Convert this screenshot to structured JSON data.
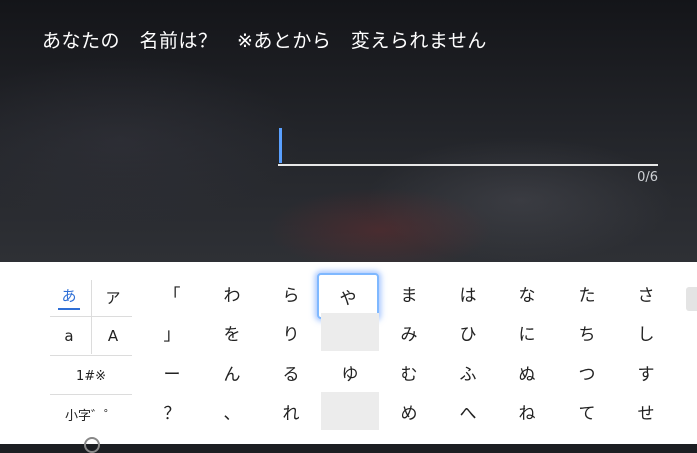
{
  "prompt": "あなたの　名前は？　※あとから　変えられません",
  "input": {
    "value": "",
    "counter": "0/6"
  },
  "keyboard": {
    "modes": {
      "hiragana": "あ",
      "katakana": "ア",
      "lowercase": "a",
      "uppercase": "A",
      "symbols": "1#※",
      "small_kana": "小字゛゜"
    },
    "columns": [
      [
        "「",
        "」",
        "ー",
        "？"
      ],
      [
        "わ",
        "を",
        "ん",
        "、"
      ],
      [
        "ら",
        "り",
        "る",
        "れ"
      ],
      [
        "や",
        "",
        "ゆ",
        ""
      ],
      [
        "ま",
        "み",
        "む",
        "め"
      ],
      [
        "は",
        "ひ",
        "ふ",
        "へ"
      ],
      [
        "な",
        "に",
        "ぬ",
        "ね"
      ],
      [
        "た",
        "ち",
        "つ",
        "て"
      ],
      [
        "さ",
        "し",
        "す",
        "せ"
      ]
    ],
    "selected_key": "や"
  }
}
